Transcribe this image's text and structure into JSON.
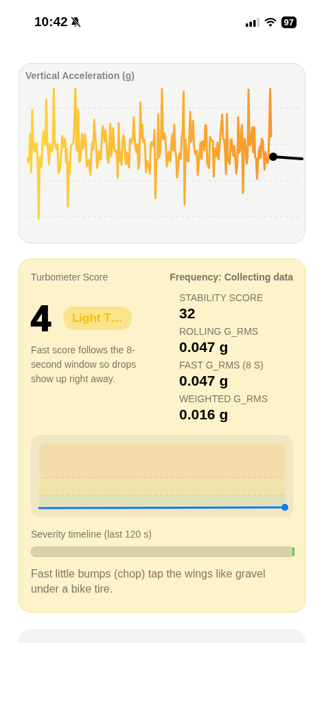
{
  "status_bar": {
    "time": "10:42",
    "silent": true,
    "battery": "97"
  },
  "acceleration_card": {
    "title": "Vertical Acceleration (g)"
  },
  "score_card": {
    "title": "Turbometer Score",
    "frequency": "Frequency: Collecting data",
    "score": "4",
    "badge": "Light T…",
    "note": "Fast score follows the 8-second window so drops show up right away.",
    "metrics": [
      {
        "label": "STABILITY SCORE",
        "value": "32"
      },
      {
        "label": "ROLLING G_RMS",
        "value": "0.047 g"
      },
      {
        "label": "FAST G_RMS (8 S)",
        "value": "0.047 g"
      },
      {
        "label": "WEIGHTED G_RMS",
        "value": "0.016 g"
      }
    ],
    "timeline_label": "Severity timeline (last 120 s)",
    "description": "Fast little bumps (chop) tap the wings like gravel under a bike tire."
  }
}
